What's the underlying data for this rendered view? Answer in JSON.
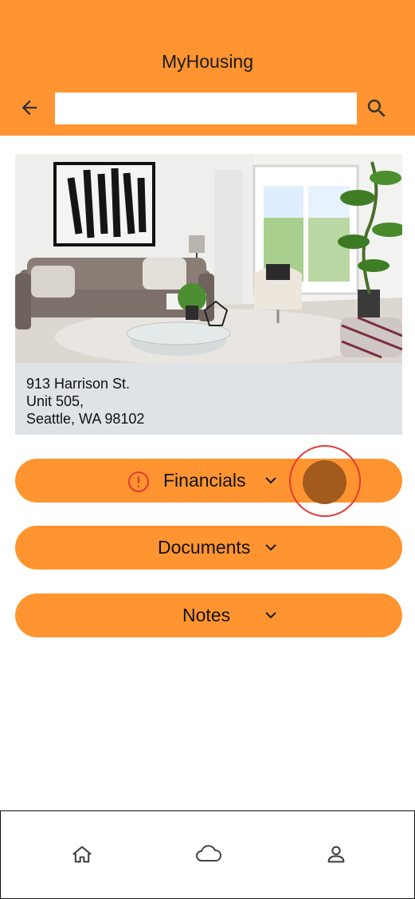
{
  "header": {
    "title": "MyHousing",
    "search_placeholder": "",
    "search_value": ""
  },
  "icons": {
    "back": "arrow-left-icon",
    "search": "search-icon",
    "alert": "alert-circle-icon",
    "chevron": "chevron-down-icon",
    "home": "home-icon",
    "cloud": "cloud-icon",
    "profile": "person-icon"
  },
  "property": {
    "address_line1": "913 Harrison St.",
    "address_line2": "Unit 505,",
    "address_line3": "Seattle, WA 98102"
  },
  "sections": {
    "financials": "Financials",
    "documents": "Documents",
    "notes": "Notes"
  },
  "colors": {
    "accent": "#ff9430",
    "card_bg": "#dfe2e6",
    "alert": "#e53935",
    "touch_indicator": "#a25a1d"
  }
}
